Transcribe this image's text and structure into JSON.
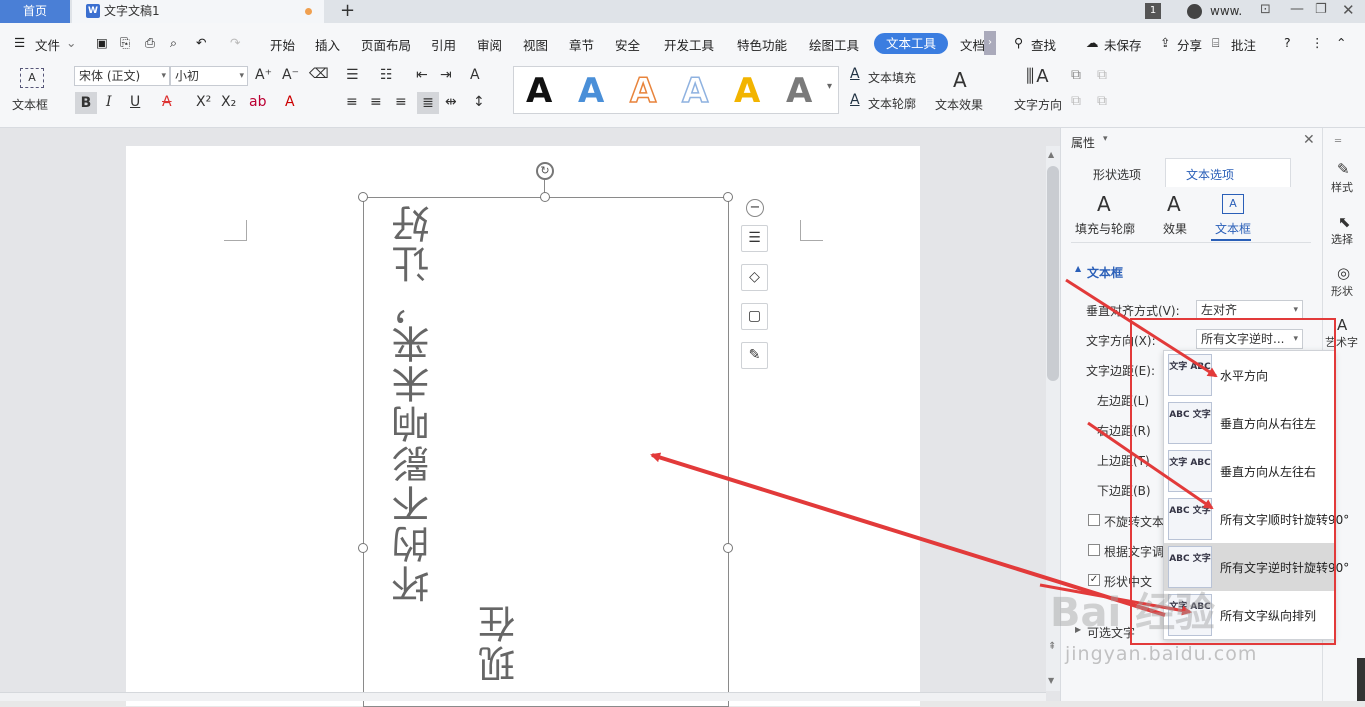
{
  "titlebar": {
    "home_tab": "首页",
    "doc_tab": "文字文稿1",
    "new_tab": "+",
    "page_count": "1",
    "user": "www."
  },
  "menubar": {
    "file": "文件",
    "items": [
      "开始",
      "插入",
      "页面布局",
      "引用",
      "审阅",
      "视图",
      "章节",
      "安全",
      "开发工具",
      "特色功能",
      "绘图工具",
      "文本工具",
      "文档"
    ],
    "search": "查找",
    "unsaved": "未保存",
    "share": "分享",
    "annotate": "批注"
  },
  "ribbon": {
    "textbox_label": "文本框",
    "font_name": "宋体 (正文)",
    "font_size": "小初",
    "text_fill": "文本填充",
    "text_outline": "文本轮廓",
    "text_effect": "文本效果",
    "text_direction": "文字方向",
    "gallery_letter": "A",
    "gallery_colors": [
      "#111111",
      "#4a8fd8",
      "#e8843c",
      "#8fb2e0",
      "#f2b400",
      "#7a7a7a"
    ]
  },
  "document": {
    "col1": "坏的不影响未来，让好",
    "col2": "现在"
  },
  "panel": {
    "title": "属性",
    "tab_shape": "形状选项",
    "tab_text": "文本选项",
    "sub_fill": "填充与轮廓",
    "sub_effect": "效果",
    "sub_textbox": "文本框",
    "section": "文本框",
    "valign_label": "垂直对齐方式(V):",
    "valign_value": "左对齐",
    "direction_label": "文字方向(X):",
    "direction_value": "所有文字逆时...",
    "margin_label": "文字边距(E):",
    "left_margin": "左边距(L)",
    "right_margin": "右边距(R)",
    "top_margin": "上边距(T)",
    "bottom_margin": "下边距(B)",
    "no_rotate": "不旋转文本",
    "autofit": "根据文字调",
    "shape_wrap": "形状中文",
    "optional_text": "可选文字"
  },
  "dropdown": {
    "options": [
      {
        "label": "水平方向",
        "icon": "文字 ABC"
      },
      {
        "label": "垂直方向从右往左",
        "icon": "ABC 文字"
      },
      {
        "label": "垂直方向从左往右",
        "icon": "文字 ABC"
      },
      {
        "label": "所有文字顺时针旋转90°",
        "icon": "ABC 文字"
      },
      {
        "label": "所有文字逆时针旋转90°",
        "icon": "ABC 文字"
      },
      {
        "label": "所有文字纵向排列",
        "icon": "文字 ABC"
      }
    ]
  },
  "rightbar": {
    "style": "样式",
    "select": "选择",
    "shape": "形状",
    "art": "艺术字"
  },
  "watermark": {
    "logo": "Bai 经验",
    "url": "jingyan.baidu.com"
  }
}
